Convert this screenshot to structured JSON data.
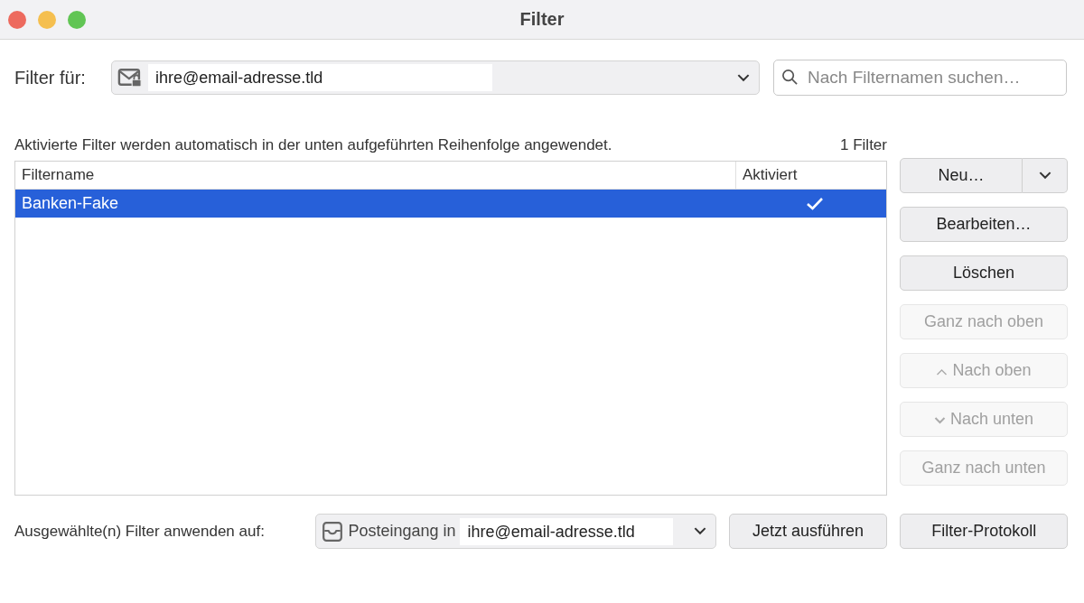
{
  "window": {
    "title": "Filter"
  },
  "filter_for": {
    "label": "Filter für:",
    "account": "ihre@email-adresse.tld"
  },
  "search": {
    "placeholder": "Nach Filternamen suchen…"
  },
  "description": "Aktivierte Filter werden automatisch in der unten aufgeführten Reihenfolge angewendet.",
  "count": "1 Filter",
  "table": {
    "columns": [
      "Filtername",
      "Aktiviert"
    ],
    "rows": [
      {
        "name": "Banken-Fake",
        "enabled": true,
        "selected": true
      }
    ]
  },
  "buttons": [
    {
      "label": "Neu…",
      "kind": "split",
      "disabled": false
    },
    {
      "label": "Bearbeiten…",
      "kind": "plain",
      "disabled": false
    },
    {
      "label": "Löschen",
      "kind": "plain",
      "disabled": false
    },
    {
      "label": "Ganz nach oben",
      "kind": "plain",
      "disabled": true
    },
    {
      "label": "Nach oben",
      "kind": "up",
      "disabled": true
    },
    {
      "label": "Nach unten",
      "kind": "down",
      "disabled": true
    },
    {
      "label": "Ganz nach unten",
      "kind": "plain",
      "disabled": true
    }
  ],
  "apply": {
    "label": "Ausgewählte(n) Filter anwenden auf:",
    "folder": "Posteingang in",
    "account": "ihre@email-adresse.tld",
    "run_button": "Jetzt ausführen"
  },
  "log_button": "Filter-Protokoll"
}
